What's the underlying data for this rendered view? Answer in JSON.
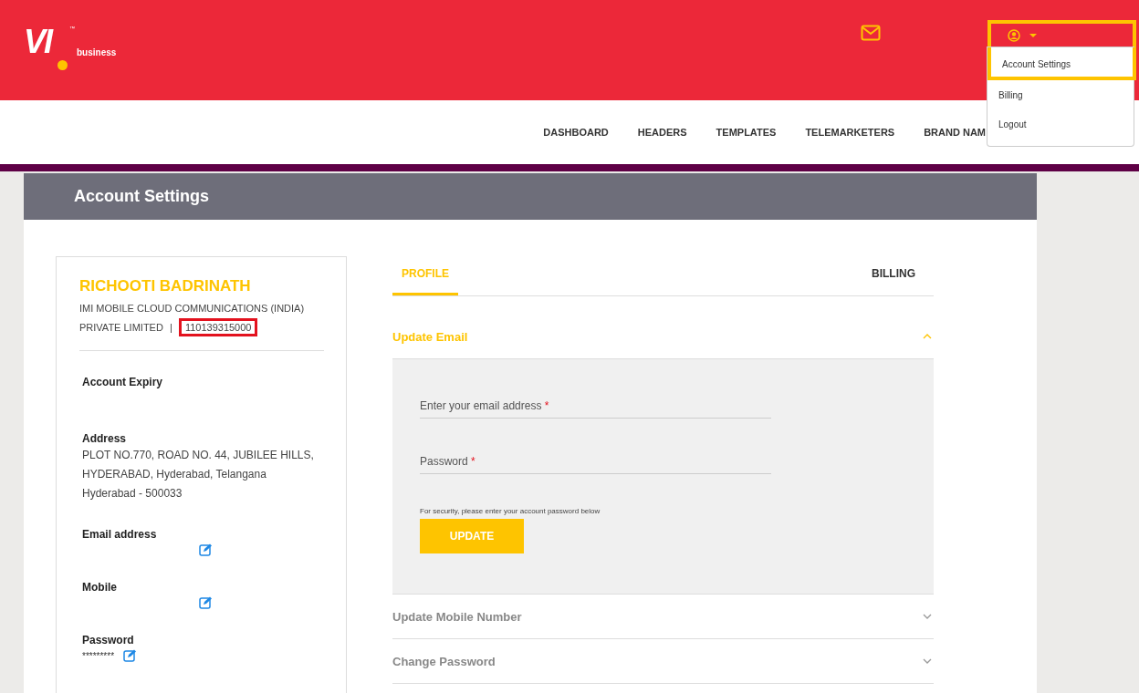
{
  "logo": {
    "mark": "VI",
    "trademark": "™",
    "tagline": "business"
  },
  "user_menu": {
    "expanded": true,
    "items": [
      {
        "label": "Account Settings",
        "highlighted": true
      },
      {
        "label": "Billing",
        "highlighted": false
      },
      {
        "label": "Logout",
        "highlighted": false
      }
    ]
  },
  "nav": [
    "DASHBOARD",
    "HEADERS",
    "TEMPLATES",
    "TELEMARKETERS",
    "BRAND NAM"
  ],
  "page_title": "Account Settings",
  "profile": {
    "name": "RICHOOTI BADRINATH",
    "company": "IMI MOBILE CLOUD COMMUNICATIONS (INDIA) PRIVATE LIMITED",
    "separator": "|",
    "account_id": "110139315000",
    "account_id_highlighted": true,
    "fields": [
      {
        "label": "Account Expiry",
        "kind": "text"
      },
      {
        "label": "Address",
        "kind": "text",
        "lines": [
          "PLOT NO.770, ROAD NO. 44, JUBILEE HILLS,",
          "HYDERABAD, Hyderabad, Telangana",
          "Hyderabad - 500033"
        ]
      },
      {
        "label": "Email address",
        "kind": "editable"
      },
      {
        "label": "Mobile",
        "kind": "editable"
      },
      {
        "label": "Password",
        "kind": "editable",
        "value": "*********"
      }
    ]
  },
  "tabs": [
    {
      "label": "PROFILE",
      "selected": true
    },
    {
      "label": "BILLING",
      "selected": false
    }
  ],
  "sections": [
    {
      "title": "Update Email",
      "expanded": true,
      "inputs": [
        {
          "placeholder": "Enter your email address",
          "required_mark": "*"
        },
        {
          "placeholder": "Password",
          "required_mark": "*"
        }
      ],
      "hint": "For security, please enter your account password below",
      "button": "UPDATE"
    },
    {
      "title": "Update Mobile Number",
      "expanded": false
    },
    {
      "title": "Change Password",
      "expanded": false
    }
  ]
}
